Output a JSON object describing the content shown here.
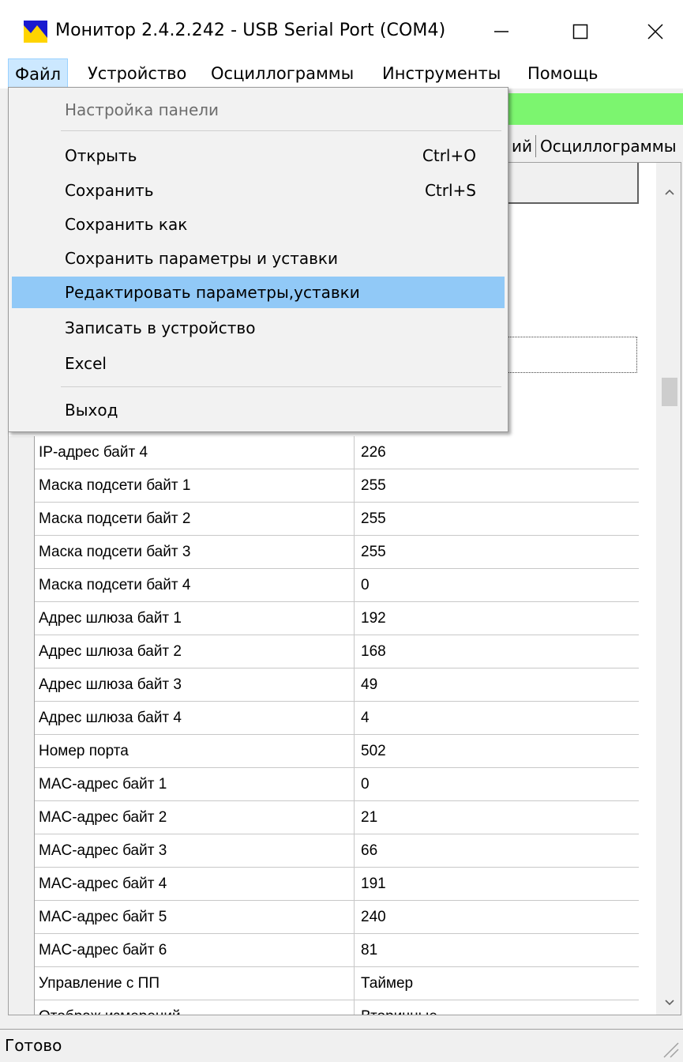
{
  "window": {
    "title": "Монитор 2.4.2.242 - USB Serial Port (COM4)",
    "minimize": "—",
    "maximize": "☐",
    "close": "✕"
  },
  "menubar": {
    "items": [
      {
        "label": "Файл"
      },
      {
        "label": "Устройство"
      },
      {
        "label": "Осциллограммы"
      },
      {
        "label": "Инструменты"
      },
      {
        "label": "Помощь"
      }
    ]
  },
  "file_menu": {
    "items": [
      {
        "label": "Настройка панели",
        "shortcut": ""
      },
      {
        "label": "Открыть",
        "shortcut": "Ctrl+O"
      },
      {
        "label": "Сохранить",
        "shortcut": "Ctrl+S"
      },
      {
        "label": "Сохранить как",
        "shortcut": ""
      },
      {
        "label": "Сохранить параметры и уставки",
        "shortcut": ""
      },
      {
        "label": "Редактировать параметры,уставки",
        "shortcut": ""
      },
      {
        "label": "Записать в устройство",
        "shortcut": ""
      },
      {
        "label": "Excel",
        "shortcut": ""
      },
      {
        "label": "Выход",
        "shortcut": ""
      }
    ]
  },
  "tabs": {
    "partial": "ий",
    "oscillograms": "Осциллограммы"
  },
  "grid": {
    "rows": [
      {
        "name": "IP-адрес байт 4",
        "value": "226"
      },
      {
        "name": "Маска подсети байт 1",
        "value": "255"
      },
      {
        "name": "Маска подсети байт 2",
        "value": "255"
      },
      {
        "name": "Маска подсети байт 3",
        "value": "255"
      },
      {
        "name": "Маска подсети байт 4",
        "value": "0"
      },
      {
        "name": "Адрес шлюза байт 1",
        "value": "192"
      },
      {
        "name": "Адрес шлюза байт 2",
        "value": "168"
      },
      {
        "name": "Адрес шлюза байт 3",
        "value": "49"
      },
      {
        "name": "Адрес шлюза байт 4",
        "value": "4"
      },
      {
        "name": "Номер порта",
        "value": "502"
      },
      {
        "name": "MAC-адрес байт 1",
        "value": "0"
      },
      {
        "name": "MAC-адрес байт 2",
        "value": "21"
      },
      {
        "name": "MAC-адрес байт 3",
        "value": "66"
      },
      {
        "name": "MAC-адрес байт 4",
        "value": "191"
      },
      {
        "name": "MAC-адрес байт 5",
        "value": "240"
      },
      {
        "name": "MAC-адрес байт 6",
        "value": "81"
      },
      {
        "name": "Управление с ПП",
        "value": "Таймер"
      },
      {
        "name": "Отображ измерений",
        "value": "Вторичные"
      }
    ]
  },
  "status": {
    "text": "Готово"
  }
}
